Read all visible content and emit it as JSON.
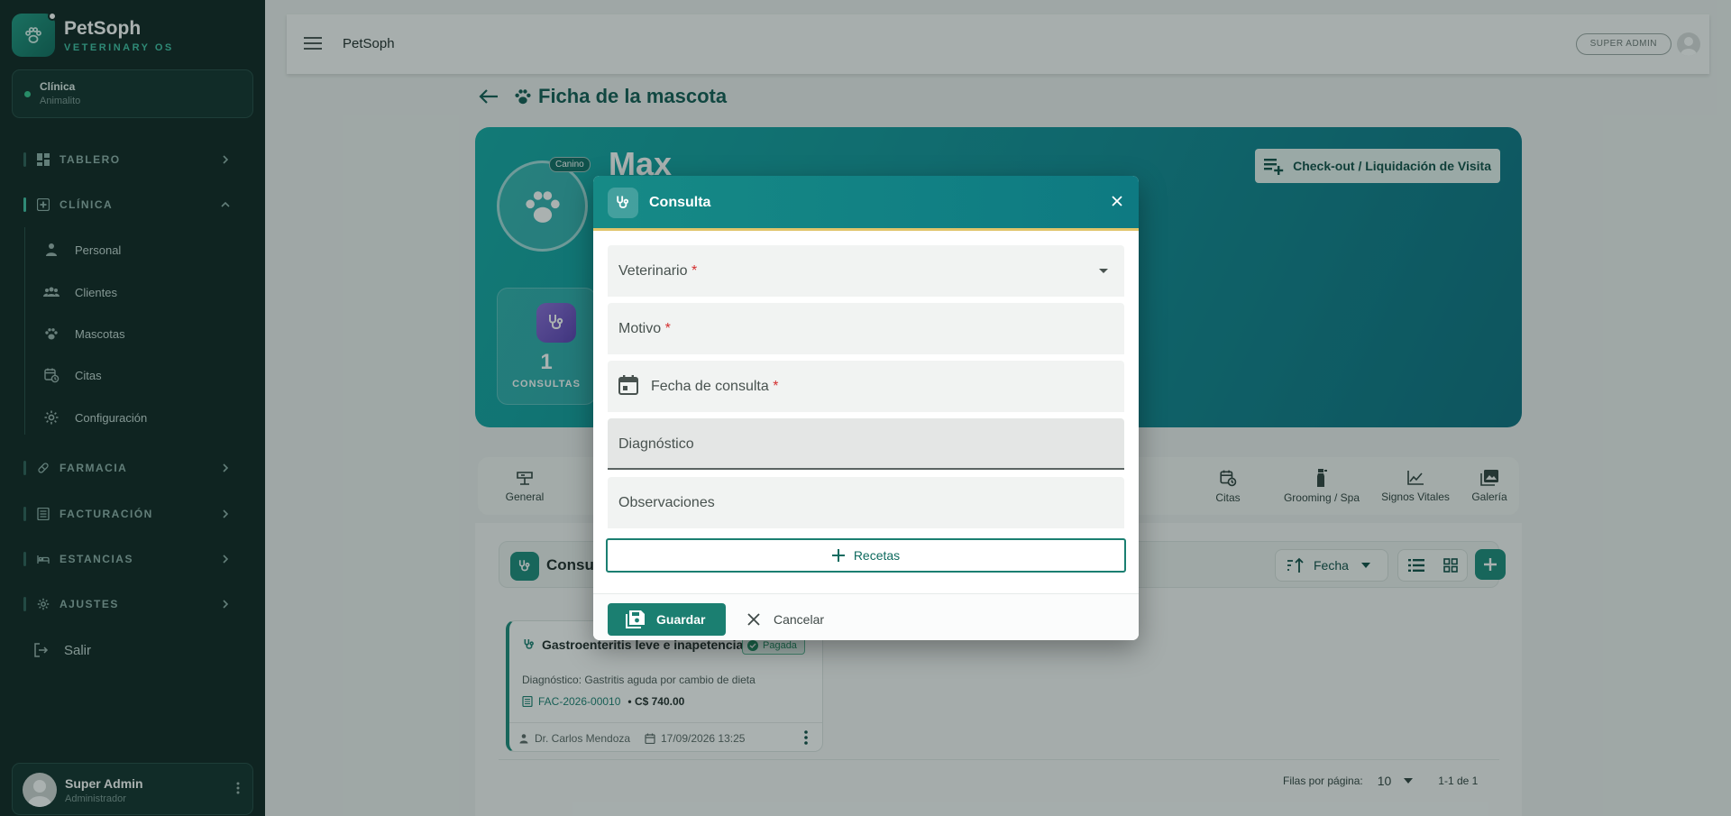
{
  "brand": {
    "name": "PetSoph",
    "subtitle": "VETERINARY OS"
  },
  "clinic": {
    "label": "Clínica",
    "name": "Animalito"
  },
  "sidebar": {
    "sections": [
      {
        "label": "TABLERO",
        "icon": "dashboard-icon",
        "expanded": false
      },
      {
        "label": "CLÍNICA",
        "icon": "clinic-cross-icon",
        "expanded": true
      },
      {
        "label": "FARMACIA",
        "icon": "pill-icon",
        "expanded": false
      },
      {
        "label": "FACTURACIÓN",
        "icon": "invoice-icon",
        "expanded": false
      },
      {
        "label": "ESTANCIAS",
        "icon": "bed-icon",
        "expanded": false
      },
      {
        "label": "AJUSTES",
        "icon": "gear-icon",
        "expanded": false
      }
    ],
    "clinic_items": [
      {
        "label": "Personal",
        "icon": "person-icon"
      },
      {
        "label": "Clientes",
        "icon": "people-icon"
      },
      {
        "label": "Mascotas",
        "icon": "paw-icon"
      },
      {
        "label": "Citas",
        "icon": "calendar-clock-icon"
      },
      {
        "label": "Configuración",
        "icon": "gear-icon"
      }
    ],
    "logout_label": "Salir"
  },
  "user": {
    "name": "Super Admin",
    "role": "Administrador"
  },
  "header": {
    "title": "PetSoph",
    "role_badge": "SUPER ADMIN"
  },
  "page": {
    "title": "Ficha de la mascota"
  },
  "pet": {
    "name": "Max",
    "species": "Canino",
    "checkout_label": "Check-out / Liquidación de Visita",
    "stats": {
      "value": "1",
      "label": "CONSULTAS"
    }
  },
  "tabs": [
    {
      "label": "General",
      "icon": "scale-icon"
    },
    {
      "label": "Citas",
      "icon": "calendar-clock-icon"
    },
    {
      "label": "Grooming / Spa",
      "icon": "spray-bottle-icon"
    },
    {
      "label": "Signos Vitales",
      "icon": "chart-line-icon"
    },
    {
      "label": "Galería",
      "icon": "gallery-icon"
    }
  ],
  "consultations": {
    "section_title": "Consul",
    "sort_label": "Fecha",
    "card": {
      "title": "Gastroenteritis leve e inapetencia",
      "badge": "Pagada",
      "diagnosis": "Diagnóstico: Gastritis aguda por cambio de dieta",
      "invoice_number": "FAC-2026-00010",
      "amount": "• C$ 740.00",
      "doctor": "Dr. Carlos Mendoza",
      "date": "17/09/2026 13:25"
    },
    "pagination": {
      "rows_label": "Filas por página:",
      "rows_value": "10",
      "range": "1-1 de 1"
    }
  },
  "dialog": {
    "title": "Consulta",
    "fields": {
      "veterinarian": "Veterinario",
      "reason": "Motivo",
      "date": "Fecha de consulta",
      "diagnosis": "Diagnóstico",
      "observations": "Observaciones",
      "required_mark": "*"
    },
    "prescriptions_label": "Recetas",
    "save_label": "Guardar",
    "cancel_label": "Cancelar"
  }
}
